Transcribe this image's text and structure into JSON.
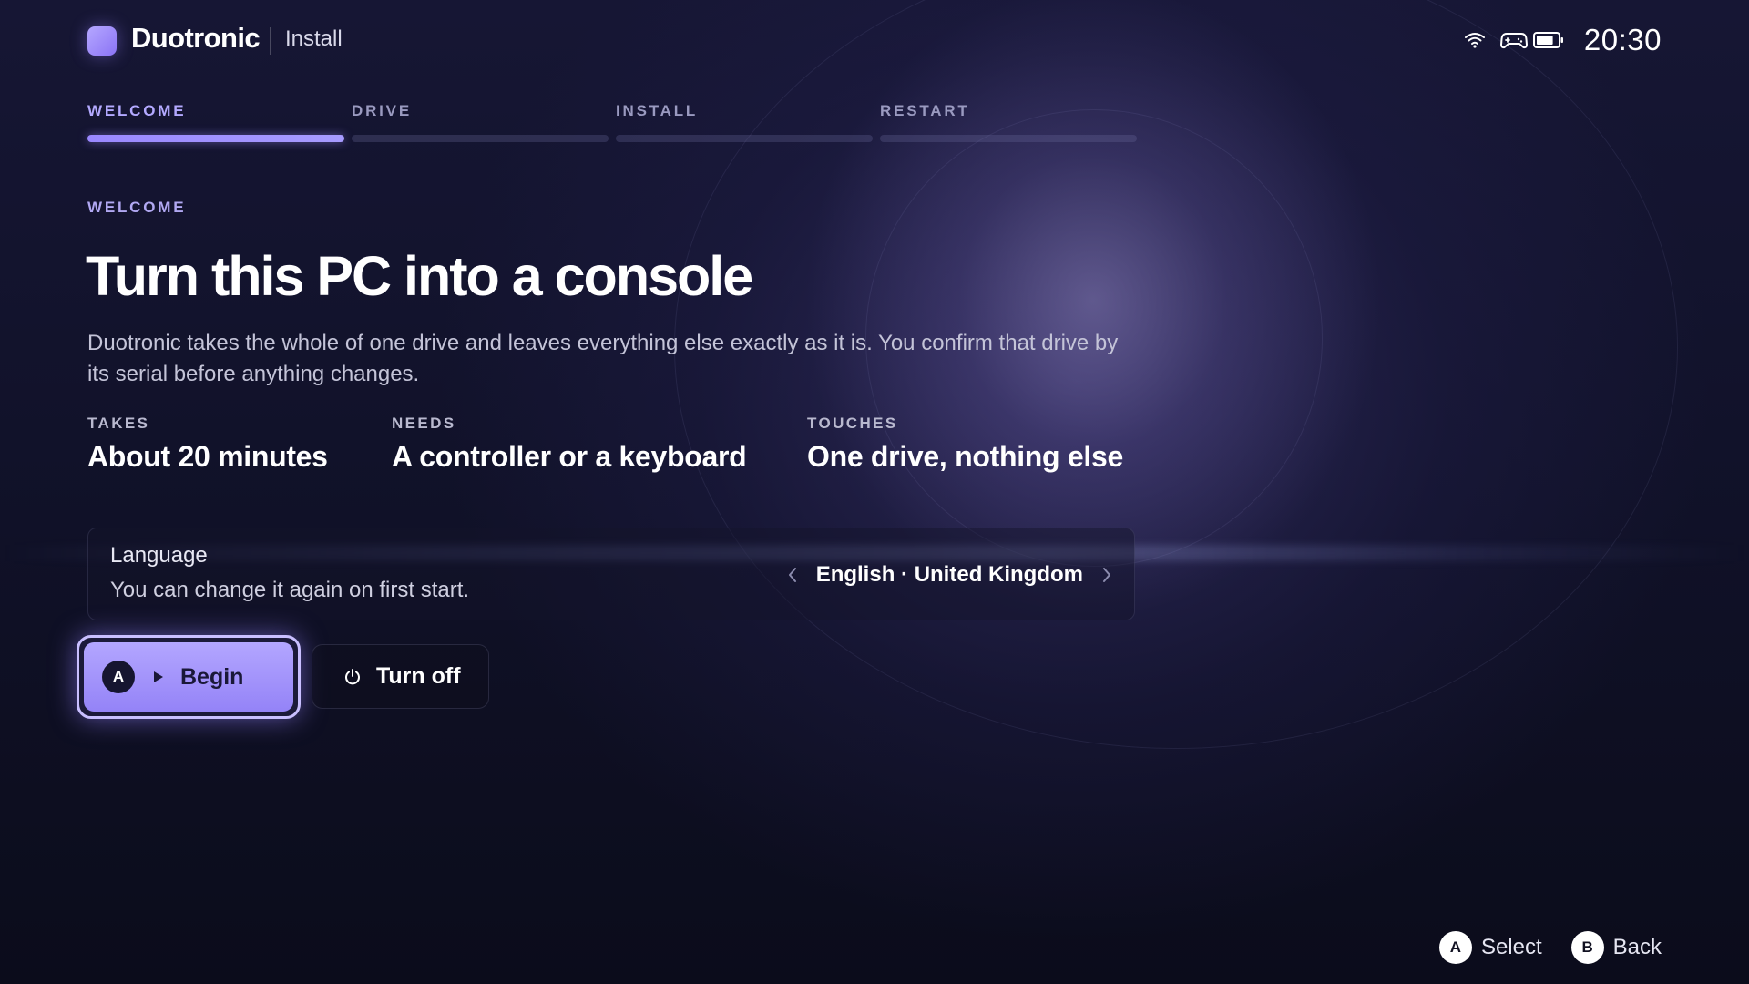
{
  "app": {
    "name": "Duotronic",
    "section": "Install",
    "accent_color": "#a99cff"
  },
  "status": {
    "wifi_icon": "wifi-icon",
    "controller_icon": "gamepad-icon",
    "battery_icon": "battery-icon",
    "battery_level": 0.8,
    "clock": "20:30"
  },
  "steps": [
    {
      "label": "WELCOME",
      "active": true
    },
    {
      "label": "DRIVE",
      "active": false
    },
    {
      "label": "INSTALL",
      "active": false
    },
    {
      "label": "RESTART",
      "active": false
    }
  ],
  "main": {
    "eyebrow": "WELCOME",
    "title": "Turn this PC into a console",
    "description": "Duotronic takes the whole of one drive and leaves everything else exactly as it is. You confirm that drive by its serial before anything changes.",
    "facts": [
      {
        "label": "TAKES",
        "value": "About 20 minutes"
      },
      {
        "label": "NEEDS",
        "value": "A controller or a keyboard"
      },
      {
        "label": "TOUCHES",
        "value": "One drive, nothing else"
      }
    ]
  },
  "language": {
    "title": "Language",
    "subtitle": "You can change it again on first start.",
    "value": "English · United Kingdom"
  },
  "actions": {
    "begin": {
      "glyph": "A",
      "label": "Begin"
    },
    "turn_off": {
      "label": "Turn off"
    }
  },
  "hints": [
    {
      "glyph": "A",
      "label": "Select"
    },
    {
      "glyph": "B",
      "label": "Back"
    }
  ]
}
